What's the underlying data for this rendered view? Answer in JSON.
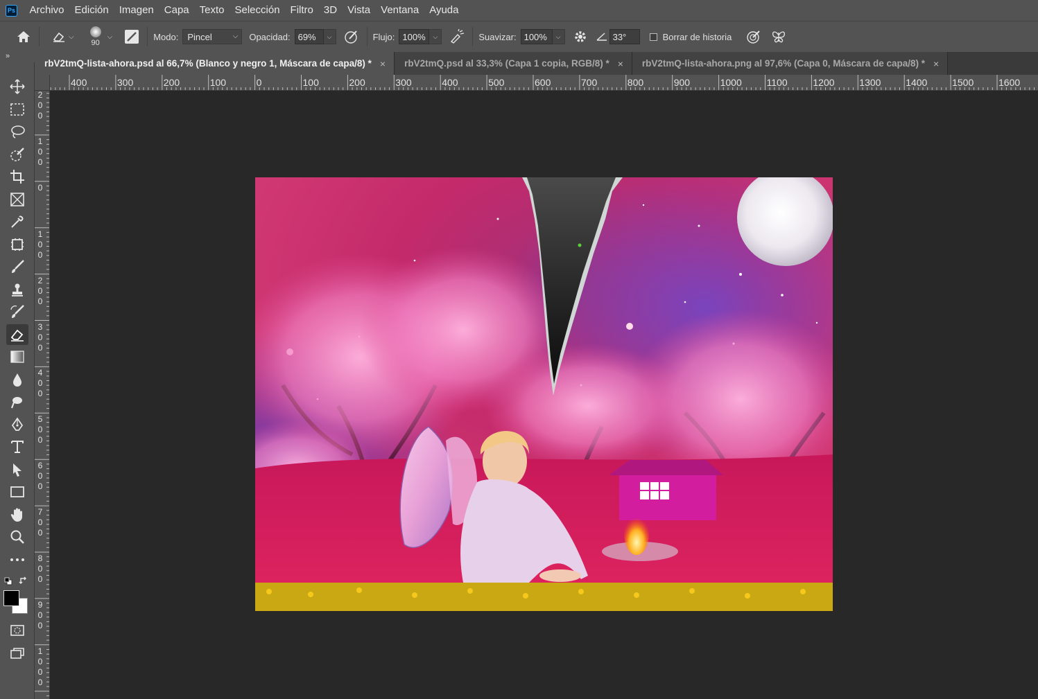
{
  "menu": [
    "Archivo",
    "Edición",
    "Imagen",
    "Capa",
    "Texto",
    "Selección",
    "Filtro",
    "3D",
    "Vista",
    "Ventana",
    "Ayuda"
  ],
  "options": {
    "brush_size": "90",
    "mode_label": "Modo:",
    "mode_value": "Pincel",
    "opacity_label": "Opacidad:",
    "opacity_value": "69%",
    "flow_label": "Flujo:",
    "flow_value": "100%",
    "smooth_label": "Suavizar:",
    "smooth_value": "100%",
    "angle_value": "33°",
    "erase_history_label": "Borrar de historia"
  },
  "tabs": [
    {
      "label": "rbV2tmQ-lista-ahora.psd al 66,7% (Blanco y negro 1, Máscara de capa/8) *",
      "close": "×"
    },
    {
      "label": "rbV2tmQ.psd al 33,3% (Capa 1 copia, RGB/8) *",
      "close": "×"
    },
    {
      "label": "rbV2tmQ-lista-ahora.png al 97,6% (Capa 0, Máscara de capa/8) *",
      "close": "×"
    }
  ],
  "ruler_h": [
    "400",
    "300",
    "200",
    "100",
    "0",
    "100",
    "200",
    "300",
    "400",
    "500",
    "600",
    "700",
    "800",
    "900",
    "1000",
    "1100",
    "1200",
    "1300",
    "1400",
    "1500",
    "1600"
  ],
  "ruler_v": [
    "2 0 0",
    "1 0 0",
    "0",
    "1 0 0",
    "2 0 0",
    "3 0 0",
    "4 0 0",
    "5 0 0",
    "6 0 0",
    "7 0 0",
    "8 0 0",
    "9 0 0",
    "1 0 0 0"
  ],
  "collapse_glyph": "»",
  "colors": {
    "foreground": "#000000",
    "background": "#ffffff"
  }
}
